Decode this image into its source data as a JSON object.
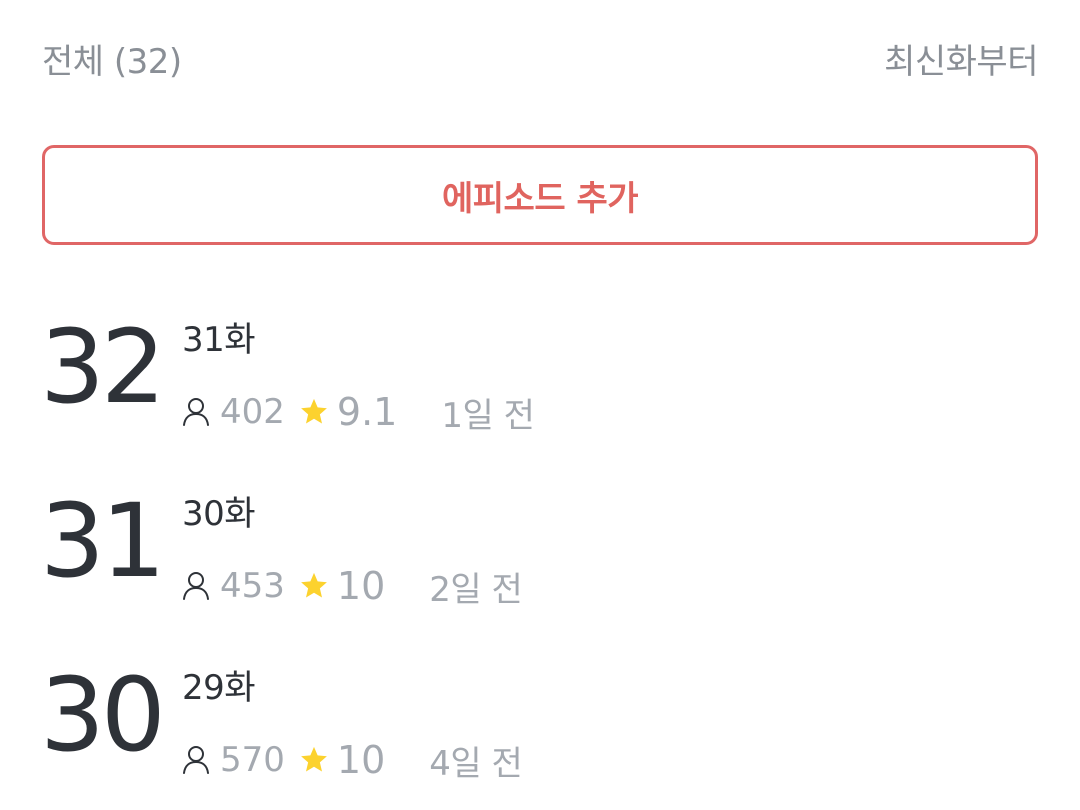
{
  "header": {
    "count_label": "전체 (32)",
    "sort_label": "최신화부터"
  },
  "add_episode": {
    "label": "에피소드 추가"
  },
  "colors": {
    "accent": "#e0645f",
    "star": "#fcd22e",
    "text_primary": "#2e3238",
    "text_muted": "#a4a9b0"
  },
  "episodes": [
    {
      "number": "32",
      "title": "31화",
      "views": "402",
      "rating": "9.1",
      "date": "1일 전"
    },
    {
      "number": "31",
      "title": "30화",
      "views": "453",
      "rating": "10",
      "date": "2일 전"
    },
    {
      "number": "30",
      "title": "29화",
      "views": "570",
      "rating": "10",
      "date": "4일 전"
    }
  ]
}
